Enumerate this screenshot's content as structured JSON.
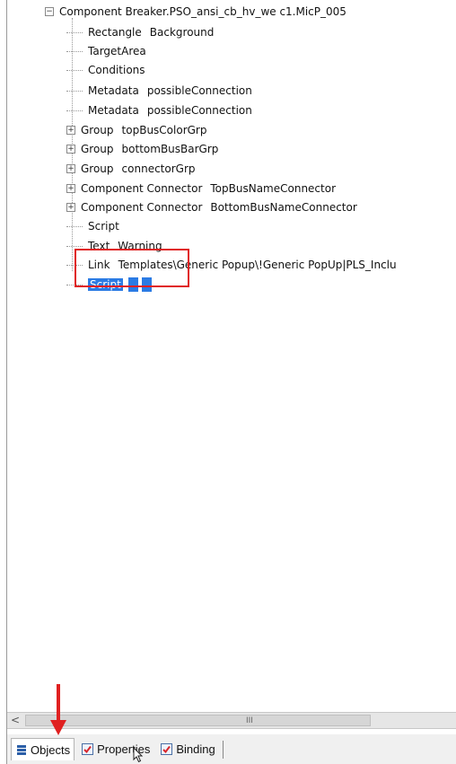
{
  "tree": {
    "root": {
      "expander": "−",
      "label": "Component Breaker.PSO_ansi_cb_hv_we  c1.MicP_005"
    },
    "items": [
      {
        "kw": "Rectangle",
        "name": "Background"
      },
      {
        "kw": "TargetArea",
        "name": ""
      },
      {
        "kw": "Conditions",
        "name": ""
      },
      {
        "kw": "Metadata",
        "name": "possibleConnection"
      },
      {
        "kw": "Metadata",
        "name": "possibleConnection"
      },
      {
        "kw": "Group",
        "name": "topBusColorGrp",
        "expander": "+"
      },
      {
        "kw": "Group",
        "name": "bottomBusBarGrp",
        "expander": "+"
      },
      {
        "kw": "Group",
        "name": "connectorGrp",
        "expander": "+"
      },
      {
        "kw": "Component Connector",
        "name": "TopBusNameConnector",
        "expander": "+"
      },
      {
        "kw": "Component Connector",
        "name": "BottomBusNameConnector",
        "expander": "+"
      },
      {
        "kw": "Script",
        "name": ""
      },
      {
        "kw": "Text",
        "name": "Warning"
      },
      {
        "kw": "Link",
        "name": "Templates\\Generic Popup\\!Generic PopUp|PLS_Inclu"
      },
      {
        "kw": "Script",
        "name": "",
        "selected": true
      }
    ]
  },
  "scrollbar": {
    "left_arrow": "<",
    "grip": "III"
  },
  "tabs": [
    {
      "label": "Objects",
      "icon": "objects-icon",
      "active": true
    },
    {
      "label": "Properties",
      "icon": "properties-checklist-icon",
      "active": false
    },
    {
      "label": "Binding",
      "icon": "binding-checklist-icon",
      "active": false
    }
  ],
  "colors": {
    "selection": "#2b7be4",
    "highlight_box": "#e02020",
    "arrow": "#e02020"
  }
}
